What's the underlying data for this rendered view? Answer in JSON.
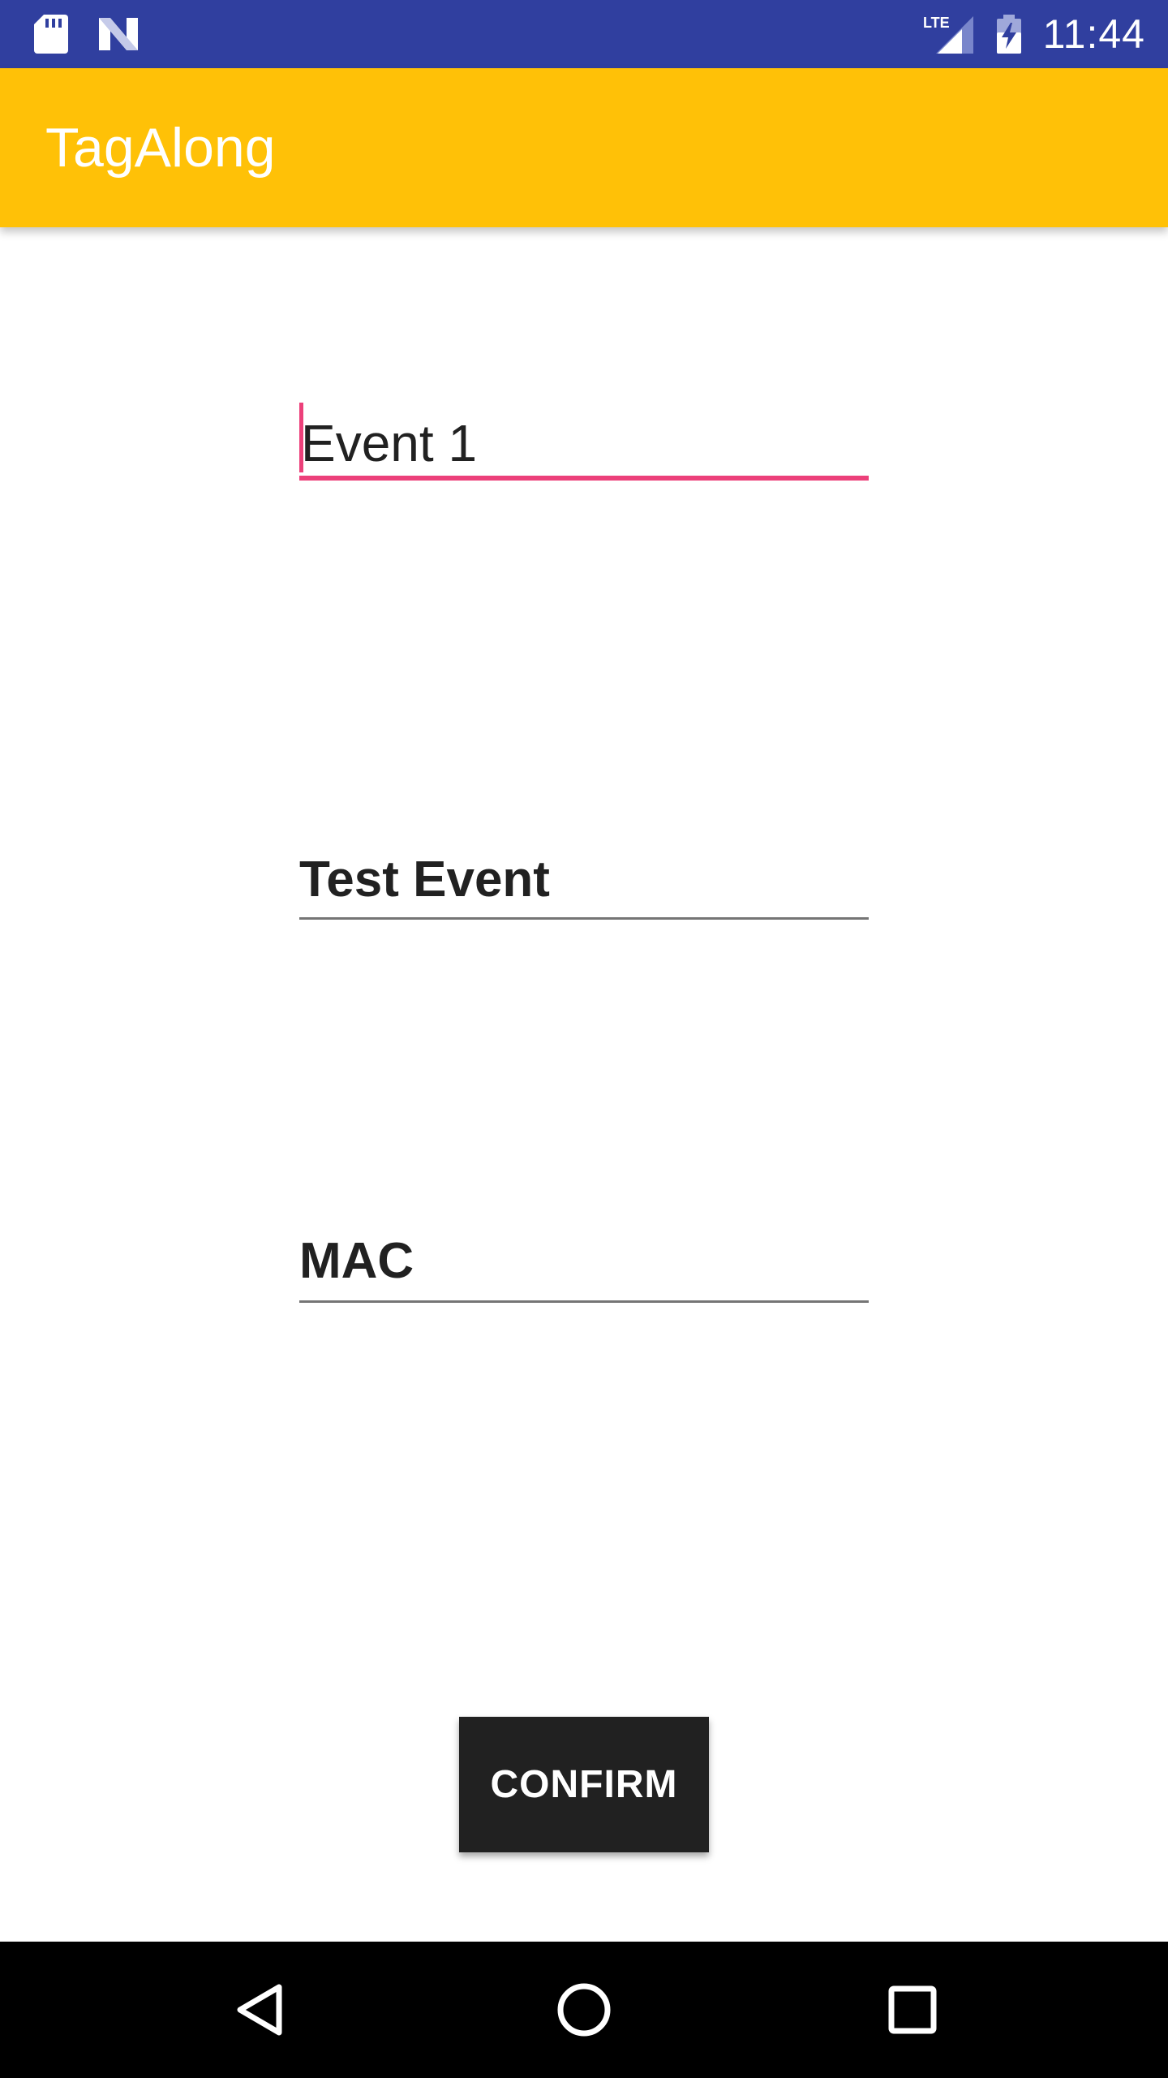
{
  "status_bar": {
    "time": "11:44",
    "left_icons": [
      "sd-card-icon",
      "n-notification-icon"
    ],
    "right_icons": [
      "lte-signal-icon",
      "battery-charging-icon"
    ],
    "network_label": "LTE",
    "background_color": "#303f9f"
  },
  "app_bar": {
    "title": "TagAlong",
    "background_color": "#ffc107"
  },
  "form": {
    "event_name_value": "Event 1",
    "event_type_value": "Test Event",
    "mac_value": "MAC",
    "accent_color": "#ec407a"
  },
  "actions": {
    "confirm_label": "CONFIRM"
  },
  "nav_bar": {
    "buttons": [
      "back-icon",
      "home-icon",
      "recents-icon"
    ]
  }
}
